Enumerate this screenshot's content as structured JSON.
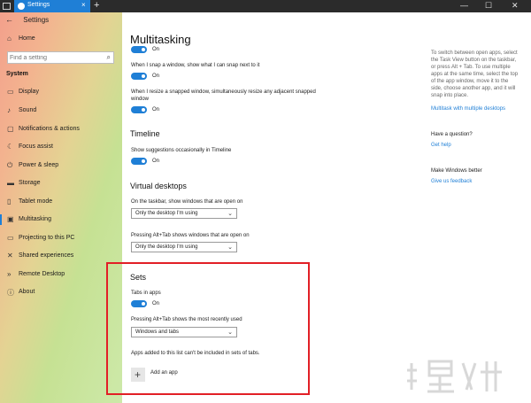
{
  "window": {
    "tab_title": "Settings",
    "close_glyph": "×",
    "add_glyph": "+",
    "minimize_glyph": "—",
    "maximize_glyph": "☐",
    "window_close_glyph": "✕",
    "accent": "#1f7fd6"
  },
  "sidebar": {
    "back_label": "Settings",
    "home_label": "Home",
    "search_placeholder": "Find a setting",
    "section": "System",
    "items": [
      {
        "label": "Display",
        "icon": "display-icon"
      },
      {
        "label": "Sound",
        "icon": "sound-icon"
      },
      {
        "label": "Notifications & actions",
        "icon": "notifications-icon"
      },
      {
        "label": "Focus assist",
        "icon": "focus-assist-icon"
      },
      {
        "label": "Power & sleep",
        "icon": "power-icon"
      },
      {
        "label": "Storage",
        "icon": "storage-icon"
      },
      {
        "label": "Tablet mode",
        "icon": "tablet-icon"
      },
      {
        "label": "Multitasking",
        "icon": "multitasking-icon",
        "active": true
      },
      {
        "label": "Projecting to this PC",
        "icon": "projecting-icon"
      },
      {
        "label": "Shared experiences",
        "icon": "shared-icon"
      },
      {
        "label": "Remote Desktop",
        "icon": "remote-desktop-icon"
      },
      {
        "label": "About",
        "icon": "info-icon"
      }
    ]
  },
  "main": {
    "title": "Multitasking",
    "snap": {
      "top_toggle_label": "On",
      "snap_next_text": "When I snap a window, show what I can snap next to it",
      "snap_next_state": "On",
      "resize_text": "When I resize a snapped window, simultaneously resize any adjacent snapped window",
      "resize_state": "On"
    },
    "timeline": {
      "heading": "Timeline",
      "text": "Show suggestions occasionally in Timeline",
      "state": "On"
    },
    "desktops": {
      "heading": "Virtual desktops",
      "taskbar_label": "On the taskbar, show windows that are open on",
      "taskbar_value": "Only the desktop I'm using",
      "alttab_label": "Pressing Alt+Tab shows windows that are open on",
      "alttab_value": "Only the desktop I'm using"
    },
    "sets": {
      "heading": "Sets",
      "tabs_label": "Tabs in apps",
      "tabs_state": "On",
      "alttab_label": "Pressing Alt+Tab shows the most recently used",
      "alttab_value": "Windows and tabs",
      "note": "Apps added to this list can't be included in sets of tabs.",
      "add_label": "Add an app",
      "highlight_color": "#e21f26"
    }
  },
  "rail": {
    "tip": "To switch between open apps, select the Task View button on the taskbar, or press Alt + Tab. To use multiple apps at the same time, select the top of the app window, move it to the side, choose another app, and it will snap into place.",
    "tip_link": "Multitask with multiple desktops",
    "question_heading": "Have a question?",
    "help_link": "Get help",
    "better_heading": "Make Windows better",
    "feedback_link": "Give us feedback"
  }
}
